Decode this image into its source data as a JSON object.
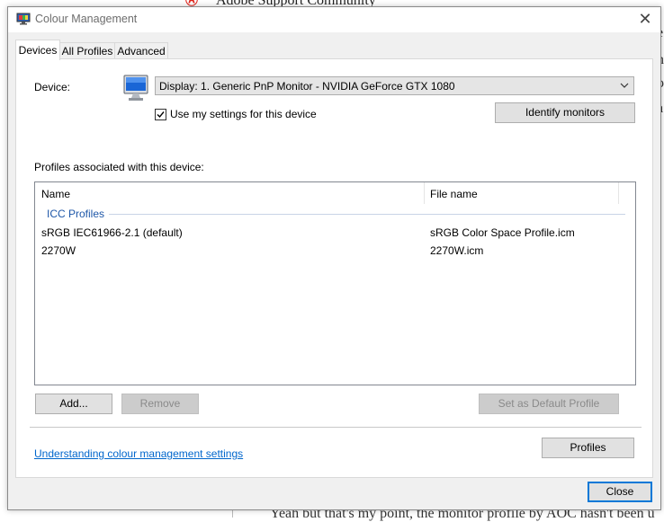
{
  "background": {
    "site_title": "Adobe Support Community",
    "right_fragments": [
      "e",
      "n",
      "o",
      "a"
    ],
    "bottom_text": "Yeah but that's my point, the monitor profile by AOC hasn't been u"
  },
  "window": {
    "title": "Colour Management",
    "close_glyph": "✕"
  },
  "tabs": [
    {
      "label": "Devices",
      "active": true
    },
    {
      "label": "All Profiles",
      "active": false
    },
    {
      "label": "Advanced",
      "active": false
    }
  ],
  "device": {
    "label": "Device:",
    "selected": "Display: 1. Generic PnP Monitor - NVIDIA GeForce GTX 1080",
    "use_settings_label": "Use my settings for this device",
    "use_settings_checked": true,
    "identify_button": "Identify monitors"
  },
  "profiles": {
    "heading": "Profiles associated with this device:",
    "columns": [
      "Name",
      "File name"
    ],
    "group": "ICC Profiles",
    "rows": [
      {
        "name": "sRGB IEC61966-2.1 (default)",
        "file": "sRGB Color Space Profile.icm"
      },
      {
        "name": "2270W",
        "file": "2270W.icm"
      }
    ]
  },
  "buttons": {
    "add": "Add...",
    "remove": "Remove",
    "set_default": "Set as Default Profile",
    "profiles": "Profiles",
    "close": "Close"
  },
  "link": "Understanding colour management settings",
  "colors": {
    "accent": "#0078d7",
    "link": "#0066cc",
    "group": "#1e57a8"
  }
}
